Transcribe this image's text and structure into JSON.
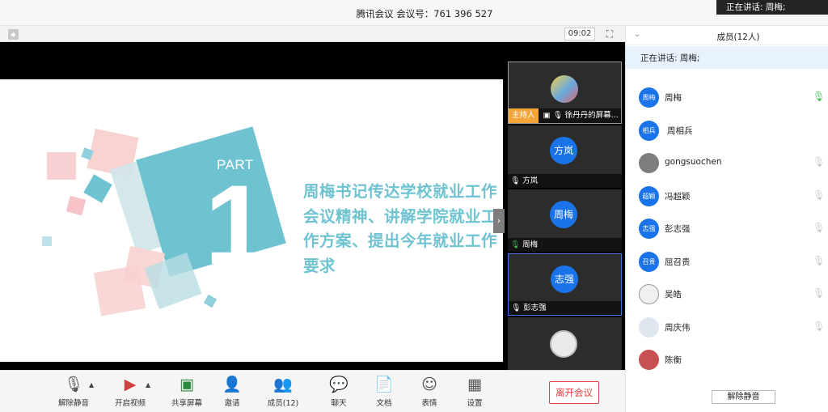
{
  "window": {
    "title": "腾讯会议  会议号：761 396 527",
    "toast": "正在讲话: 周梅;"
  },
  "video_bar": {
    "timer": "09:02"
  },
  "slide": {
    "part_label": "PART",
    "part_number": "1",
    "text": "周梅书记传达学校就业工作会议精神、讲解学院就业工作方案、提出今年就业工作要求"
  },
  "tiles": [
    {
      "host_badge": "主持人",
      "label": "徐丹丹的屏幕...",
      "avatar": ""
    },
    {
      "label": "方岚",
      "avatar": "方岚",
      "mic": "muted"
    },
    {
      "label": "周梅",
      "avatar": "周梅",
      "mic": "on"
    },
    {
      "label": "彭志强",
      "avatar": "志强",
      "mic": "muted"
    },
    {
      "label": "",
      "avatar": ""
    }
  ],
  "toolbar": {
    "unmute": "解除静音",
    "video": "开启视频",
    "share": "共享屏幕",
    "invite": "邀请",
    "members": "成员(12)",
    "chat": "聊天",
    "docs": "文档",
    "emoji": "表情",
    "settings": "设置",
    "leave": "离开会议"
  },
  "sidebar": {
    "header": "成员(12人)",
    "speaking": "正在讲话: 周梅;",
    "members": [
      {
        "name": "周梅",
        "avatar": "周梅",
        "mic": "on"
      },
      {
        "name": "周相兵",
        "avatar": "相兵",
        "mic": "none"
      },
      {
        "name": "gongsuochen",
        "avatar": "",
        "mic": "muted"
      },
      {
        "name": "冯超颖",
        "avatar": "超颖",
        "mic": "muted"
      },
      {
        "name": "彭志强",
        "avatar": "志强",
        "mic": "muted"
      },
      {
        "name": "屈召贵",
        "avatar": "召贵",
        "mic": "muted"
      },
      {
        "name": "吴皓",
        "avatar": "",
        "mic": "muted"
      },
      {
        "name": "周庆伟",
        "avatar": "",
        "mic": "muted"
      },
      {
        "name": "陈衡",
        "avatar": "",
        "mic": "none"
      }
    ],
    "unmute_all": "解除静音"
  },
  "colors": {
    "accent": "#1a73e8",
    "danger": "#e34141",
    "slide_text": "#6fc3d1",
    "host_badge": "#f4a53a",
    "mic_on": "#3ec04f"
  }
}
